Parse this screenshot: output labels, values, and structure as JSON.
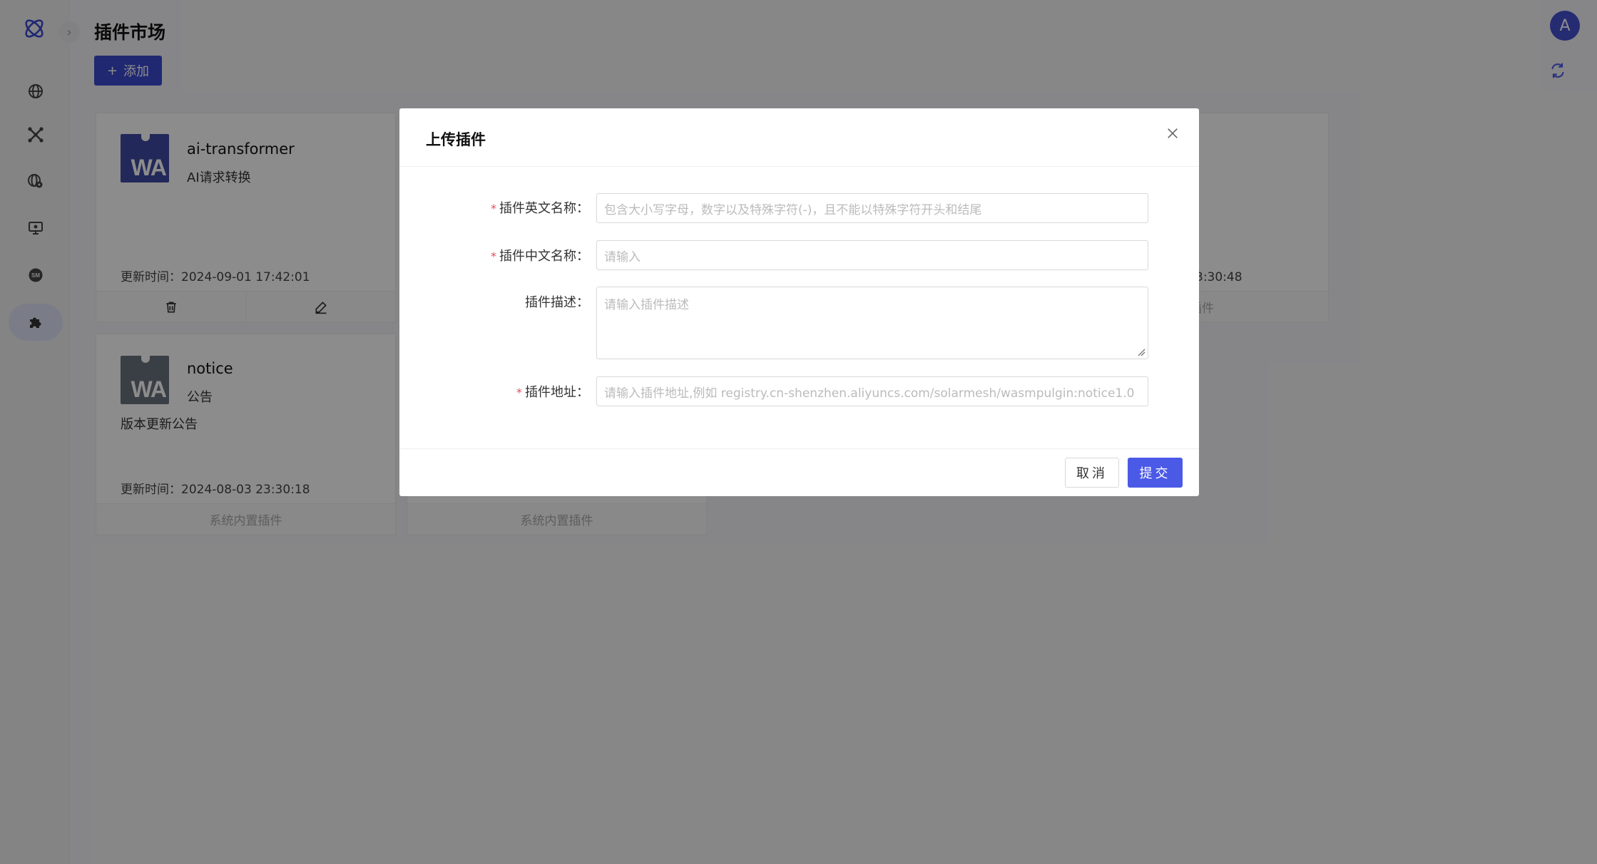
{
  "page": {
    "title": "插件市场",
    "add_label": "添加",
    "avatar_letter": "A"
  },
  "sidebar": {
    "items": [
      {
        "icon": "globe-icon"
      },
      {
        "icon": "route-icon"
      },
      {
        "icon": "domain-settings-icon"
      },
      {
        "icon": "monitor-icon"
      },
      {
        "icon": "certificate-icon"
      },
      {
        "icon": "plugin-icon",
        "active": true
      }
    ]
  },
  "cards": [
    {
      "name": "ai-transformer",
      "subtitle": "AI请求转换",
      "description": "",
      "time_label": "更新时间：2024-09-01 17:42:01",
      "thumb_text": "WA",
      "thumb_color": "#3f4aa3"
    },
    {
      "name": "notice",
      "subtitle": "公告",
      "description": "版本更新公告",
      "time_label": "更新时间：2024-08-03 23:30:18",
      "thumb_text": "WA",
      "thumb_color": "#6b7480",
      "footer": "系统内置插件"
    },
    {
      "footer": "系统内置插件"
    },
    {
      "time_fragment": "3:30:48",
      "footer_fragment": "插件"
    }
  ],
  "modal": {
    "title": "上传插件",
    "fields": [
      {
        "label": "插件英文名称：",
        "required": true,
        "placeholder": "包含大小写字母，数字以及特殊字符(-)，且不能以特殊字符开头和结尾"
      },
      {
        "label": "插件中文名称：",
        "required": true,
        "placeholder": "请输入"
      },
      {
        "label": "插件描述：",
        "required": false,
        "placeholder": "请输入插件描述"
      },
      {
        "label": "插件地址：",
        "required": true,
        "placeholder": "请输入插件地址,例如 registry.cn-shenzhen.aliyuncs.com/solarmesh/wasmpulgin:notice1.0"
      }
    ],
    "cancel_label": "取消",
    "submit_label": "提交"
  },
  "colors": {
    "primary": "#4a5ae6",
    "required": "#e34d59",
    "mask": "rgba(0,0,0,0.45)"
  }
}
